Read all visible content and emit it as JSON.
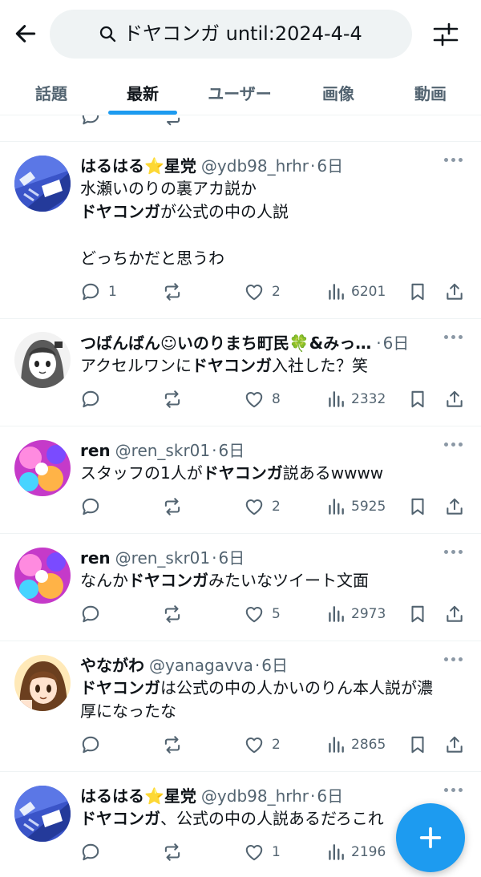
{
  "header": {
    "search_query": "ドヤコンガ until:2024-4-4"
  },
  "tabs": [
    {
      "label": "話題"
    },
    {
      "label": "最新"
    },
    {
      "label": "ユーザー"
    },
    {
      "label": "画像"
    },
    {
      "label": "動画"
    }
  ],
  "active_tab": "最新",
  "posts": [
    {
      "name": "はるはる⭐星党",
      "handle": "@ydb98_hrhr",
      "time": "6日",
      "text_html": "水瀬いのりの裏アカ説か\n<b>ドヤコンガ</b>が公式の中の人説\n\nどっちかだと思うわ",
      "replies": "1",
      "likes": "2",
      "views": "6201",
      "avatar": "jersey"
    },
    {
      "name": "つばんばん☺いのりまち町民🍀&みっ…",
      "handle": "",
      "time": "6日",
      "text_html": "アクセルワンに<b>ドヤコンガ</b>入社した？笑",
      "replies": "",
      "likes": "8",
      "views": "2332",
      "avatar": "anime-gray"
    },
    {
      "name": "ren",
      "handle": "@ren_skr01",
      "time": "6日",
      "text_html": "スタッフの1人が<b>ドヤコンガ</b>説あるwwww",
      "replies": "",
      "likes": "2",
      "views": "5925",
      "avatar": "colorful"
    },
    {
      "name": "ren",
      "handle": "@ren_skr01",
      "time": "6日",
      "text_html": "なんか<b>ドヤコンガ</b>みたいなツイート文面",
      "replies": "",
      "likes": "5",
      "views": "2973",
      "avatar": "colorful"
    },
    {
      "name": "やながわ",
      "handle": "@yanagavva",
      "time": "6日",
      "text_html": "<b>ドヤコンガ</b>は公式の中の人かいのりん本人説が濃\n厚になったな",
      "replies": "",
      "likes": "2",
      "views": "2865",
      "avatar": "anime-brown"
    },
    {
      "name": "はるはる⭐星党",
      "handle": "@ydb98_hrhr",
      "time": "6日",
      "text_html": "<b>ドヤコンガ</b>、公式の中の人説あるだろこれ",
      "replies": "",
      "likes": "1",
      "views": "2196",
      "avatar": "jersey"
    }
  ],
  "colors": {
    "accent": "#1d9bf0",
    "text": "#0f1419",
    "secondary": "#536471",
    "divider": "#eff3f4"
  }
}
